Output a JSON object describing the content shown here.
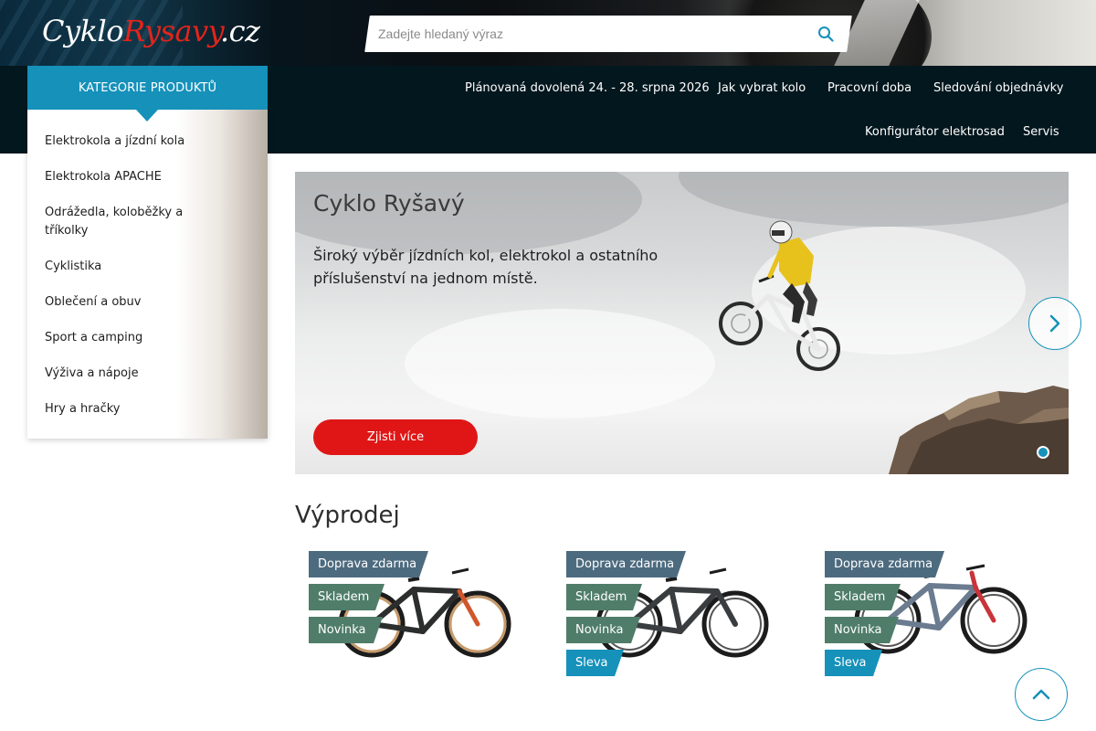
{
  "header": {
    "logo": {
      "part1": "Cyklo",
      "part2": "Rysavy",
      "part3": ".cz"
    },
    "search": {
      "placeholder": "Zadejte hledaný výraz",
      "value": ""
    }
  },
  "nav": {
    "category_tab": "KATEGORIE PRODUKTŮ",
    "links": [
      "Plánovaná dovolená 24. - 28. srpna 2026",
      "Jak vybrat kolo",
      "Pracovní doba",
      "Sledování objednávky",
      "Konfigurátor elektrosad",
      "Servis"
    ]
  },
  "sidebar": {
    "items": [
      "Elektrokola a jízdní kola",
      "Elektrokola APACHE",
      "Odrážedla, koloběžky a tříkolky",
      "Cyklistika",
      "Oblečení a obuv",
      "Sport a camping",
      "Výživa a nápoje",
      "Hry a hračky"
    ]
  },
  "hero": {
    "title": "Cyklo Ryšavý",
    "text": "Široký výběr jízdních kol, elektrokol a ostatního příslušenství na jednom místě.",
    "button": "Zjisti více"
  },
  "sale": {
    "title": "Výprodej",
    "products": [
      {
        "badges": {
          "free": "Doprava zdarma",
          "stock": "Skladem",
          "new": "Novinka"
        }
      },
      {
        "badges": {
          "free": "Doprava zdarma",
          "stock": "Skladem",
          "new": "Novinka",
          "sale": "Sleva"
        }
      },
      {
        "badges": {
          "free": "Doprava zdarma",
          "stock": "Skladem",
          "new": "Novinka",
          "sale": "Sleva"
        }
      }
    ]
  },
  "colors": {
    "accent": "#1591ba",
    "cta_red": "#e01616",
    "logo_red": "#e3241b",
    "nav_bg": "#03171e",
    "badge_slate": "#4d6b7f",
    "badge_green": "#4f7d6a"
  },
  "icons": {
    "search": "search-icon",
    "hero_next": "chevron-right-icon",
    "scroll_top": "chevron-up-icon"
  }
}
